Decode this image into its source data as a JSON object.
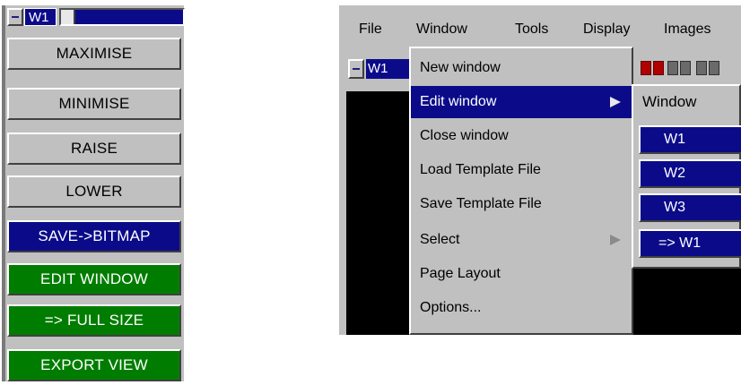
{
  "left_panel": {
    "window_tab": "W1",
    "buttons": [
      {
        "label": "MAXIMISE",
        "color": "#c0c0c0"
      },
      {
        "label": "MINIMISE",
        "color": "#c0c0c0"
      },
      {
        "label": "RAISE",
        "color": "#c0c0c0"
      },
      {
        "label": "LOWER",
        "color": "#c0c0c0"
      },
      {
        "label": "SAVE->BITMAP",
        "color": "#0b0b8a"
      },
      {
        "label": "EDIT WINDOW",
        "color": "#007d00"
      },
      {
        "label": "=> FULL SIZE",
        "color": "#007d00"
      },
      {
        "label": "EXPORT VIEW",
        "color": "#007d00"
      }
    ]
  },
  "right_window": {
    "menubar": [
      "File",
      "Window",
      "Tools",
      "Display",
      "Images"
    ],
    "window_tab": "W1"
  },
  "dropdown": {
    "items": [
      {
        "label": "New window"
      },
      {
        "label": "Edit window",
        "selected": true,
        "submenu_arrow": true
      },
      {
        "label": "Close window"
      },
      {
        "label": "Load Template File"
      },
      {
        "label": "Save Template File"
      },
      {
        "label": "Select",
        "submenu_arrow": true
      },
      {
        "label": "Page Layout"
      },
      {
        "label": "Options..."
      }
    ]
  },
  "submenu": {
    "title": "Window",
    "items": [
      "W1",
      "W2",
      "W3",
      "=> W1"
    ]
  },
  "colors": {
    "panel_grey": "#c0c0c0",
    "selection_blue": "#0b0b8a",
    "action_green": "#007d00"
  }
}
